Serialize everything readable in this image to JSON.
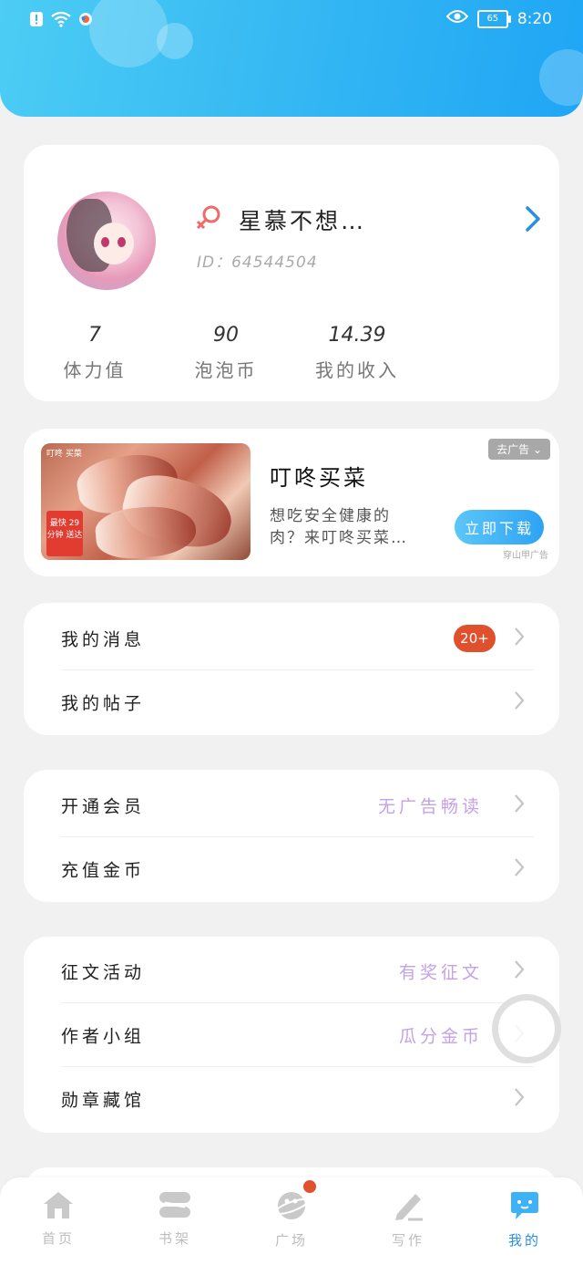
{
  "status_bar": {
    "time": "8:20",
    "battery": "65"
  },
  "profile": {
    "nickname": "星慕不想…",
    "uid": "ID：64544504",
    "stats": [
      {
        "value": "7",
        "label": "体力值"
      },
      {
        "value": "90",
        "label": "泡泡币"
      },
      {
        "value": "14.39",
        "label": "我的收入"
      }
    ]
  },
  "ad": {
    "title": "叮咚买菜",
    "description": "想吃安全健康的肉？来叮咚买菜…",
    "close_label": "去广告",
    "download_label": "立即下载",
    "source": "穿山甲广告",
    "image_brand": "叮咚 买菜",
    "image_tag": "最快 29分钟 送达"
  },
  "menu_group1": [
    {
      "label": "我的消息",
      "badge": "20+"
    },
    {
      "label": "我的帖子"
    }
  ],
  "menu_group2": [
    {
      "label": "开通会员",
      "hint": "无广告畅读"
    },
    {
      "label": "充值金币"
    }
  ],
  "menu_group3": [
    {
      "label": "征文活动",
      "hint": "有奖征文"
    },
    {
      "label": "作者小组",
      "hint": "瓜分金币"
    },
    {
      "label": "勋章藏馆"
    }
  ],
  "bottom_nav": [
    {
      "label": "首页",
      "icon": "home-icon"
    },
    {
      "label": "书架",
      "icon": "bookshelf-icon"
    },
    {
      "label": "广场",
      "icon": "plaza-icon"
    },
    {
      "label": "写作",
      "icon": "pen-icon"
    },
    {
      "label": "我的",
      "icon": "profile-chat-icon"
    }
  ],
  "colors": {
    "accent": "#2a8fe0",
    "hint": "#c4a2e6",
    "badge": "#e0502d"
  }
}
